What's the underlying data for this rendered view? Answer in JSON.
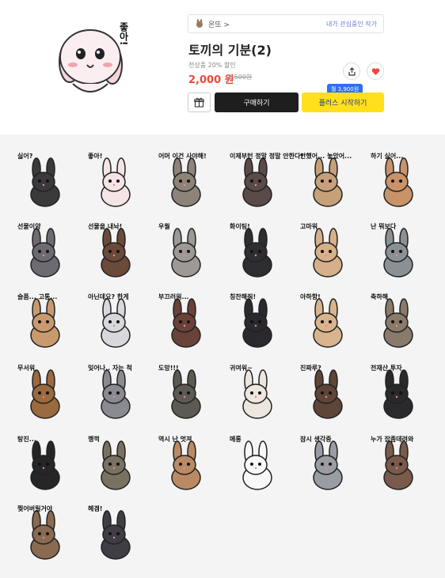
{
  "product": {
    "author_name": "온또 >",
    "favorite_label": "내가 관심중인 작가",
    "title": "토끼의 기분(2)",
    "discount_text": "전상품 20% 할인",
    "price": "2,000 원",
    "original_price": "2,500원",
    "buy_label": "구매하기",
    "plus_label": "플러스 시작하기",
    "plus_badge": "월 3,900원",
    "thumbnail_text": "좋아!"
  },
  "colors": {
    "price": "#f0463c",
    "plus_button": "#ffe01a",
    "buy_button": "#1e1e1e",
    "badge": "#2f6ef5",
    "heart": "#f0463c",
    "gallery_bg": "#f4f4f4"
  },
  "stickers": [
    {
      "caption": "싫어?",
      "fur": "#3a3a3d"
    },
    {
      "caption": "좋아!",
      "fur": "#f5e4e6"
    },
    {
      "caption": "어머 이건 사야해!",
      "fur": "#8c8478"
    },
    {
      "caption": "이제부턴 정말 정말 안한다!",
      "fur": "#5a4a48"
    },
    {
      "caption": "안했어... 놓았어...",
      "fur": "#c7a07a"
    },
    {
      "caption": "하기 싫어...",
      "fur": "#c9936a"
    },
    {
      "caption": "선물이얌",
      "fur": "#6e6a72"
    },
    {
      "caption": "선물을 내놔!",
      "fur": "#6b4a3a"
    },
    {
      "caption": "우월",
      "fur": "#9d9a96"
    },
    {
      "caption": "화이팅!",
      "fur": "#2e2e32"
    },
    {
      "caption": "고마워",
      "fur": "#d6b08a"
    },
    {
      "caption": "난 뭐보다",
      "fur": "#8a9094"
    },
    {
      "caption": "슬픔... 고통...",
      "fur": "#c89a6e"
    },
    {
      "caption": "아닌데요? 한게",
      "fur": "#d8d8dc"
    },
    {
      "caption": "부끄러워...",
      "fur": "#6a4238"
    },
    {
      "caption": "칭찬해줘!",
      "fur": "#2a2a2e"
    },
    {
      "caption": "아하항!",
      "fur": "#d8b48e"
    },
    {
      "caption": "축하해",
      "fur": "#8a7a6c"
    },
    {
      "caption": "무서워",
      "fur": "#9b6a3e"
    },
    {
      "caption": "잊어나.. 자는 척",
      "fur": "#8a8a92"
    },
    {
      "caption": "도망!!!",
      "fur": "#5c5a52"
    },
    {
      "caption": "귀여워~",
      "fur": "#ece6de"
    },
    {
      "caption": "진짜루?",
      "fur": "#5e4538"
    },
    {
      "caption": "전재산 투자",
      "fur": "#2a2a2c"
    },
    {
      "caption": "탕진...",
      "fur": "#262628"
    },
    {
      "caption": "깽꺽",
      "fur": "#7a7260"
    },
    {
      "caption": "역시 난 멋져",
      "fur": "#b98a64"
    },
    {
      "caption": "메롱",
      "fur": "#f8f8f8"
    },
    {
      "caption": "잠시 생각중",
      "fur": "#9a9ca4"
    },
    {
      "caption": "누가 잡좀데려와",
      "fur": "#7a5a4a"
    },
    {
      "caption": "찢어버릴거야",
      "fur": "#8a6a50"
    },
    {
      "caption": "헤겜!",
      "fur": "#3e3e44"
    }
  ]
}
